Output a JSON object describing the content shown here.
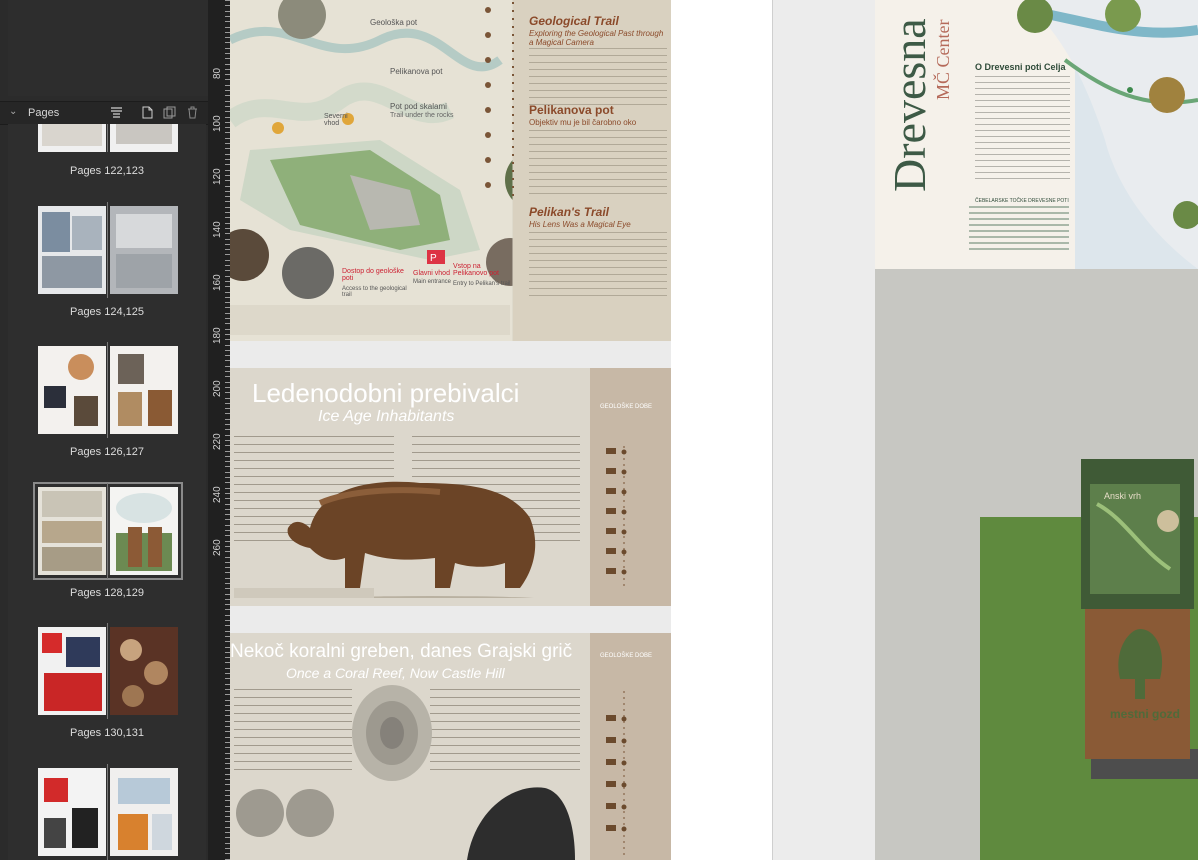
{
  "panel": {
    "title": "Pages",
    "spreads": [
      {
        "label": "Pages 122,123"
      },
      {
        "label": "Pages 124,125"
      },
      {
        "label": "Pages 126,127"
      },
      {
        "label": "Pages 128,129"
      },
      {
        "label": "Pages 130,131"
      }
    ]
  },
  "ruler": {
    "marks": [
      "80",
      "100",
      "120",
      "140",
      "160",
      "180",
      "200",
      "220",
      "240",
      "260"
    ]
  },
  "sheets": {
    "trail": {
      "geo_title": "Geological Trail",
      "geo_sub": "Exploring the Geological Past through a Magical Camera",
      "pel_title": "Pelikanova pot",
      "pel_sub": "Objektiv mu je bil čarobno oko",
      "pel_en_title": "Pelikan's Trail",
      "pel_en_sub": "His Lens Was a Magical Eye",
      "geo_pot": "Geološka pot",
      "pelikan_pot": "Pelikanova pot",
      "pot_pod": "Pot pod skalami",
      "pot_pod_en": "Trail under the rocks",
      "severni": "Severni vhod",
      "glavni": "Glavni vhod",
      "glavni_en": "Main entrance",
      "vstop": "Vstop na Pelikanovo pot",
      "vstop_en": "Entry to Pelikan's trail",
      "dostop": "Dostop do geološke poti",
      "dostop_en": "Access to the geological trail"
    },
    "ice": {
      "title": "Ledenodobni prebivalci",
      "subtitle": "Ice Age Inhabitants",
      "side": "GEOLOŠKE DOBE"
    },
    "reef": {
      "title": "Nekoč koralni greben, danes Grajski grič",
      "subtitle": "Once a Coral Reef, Now Castle Hill",
      "side": "GEOLOŠKE DOBE"
    },
    "drevesna": {
      "big": "Drevesna",
      "small": "MČ Center",
      "heading": "O Drevesni poti Celja",
      "list_title": "ČEBELARSKE TOČKE DREVESNE POTI"
    },
    "sign": {
      "top": "Anski vrh",
      "logo": "mestni gozd"
    }
  }
}
